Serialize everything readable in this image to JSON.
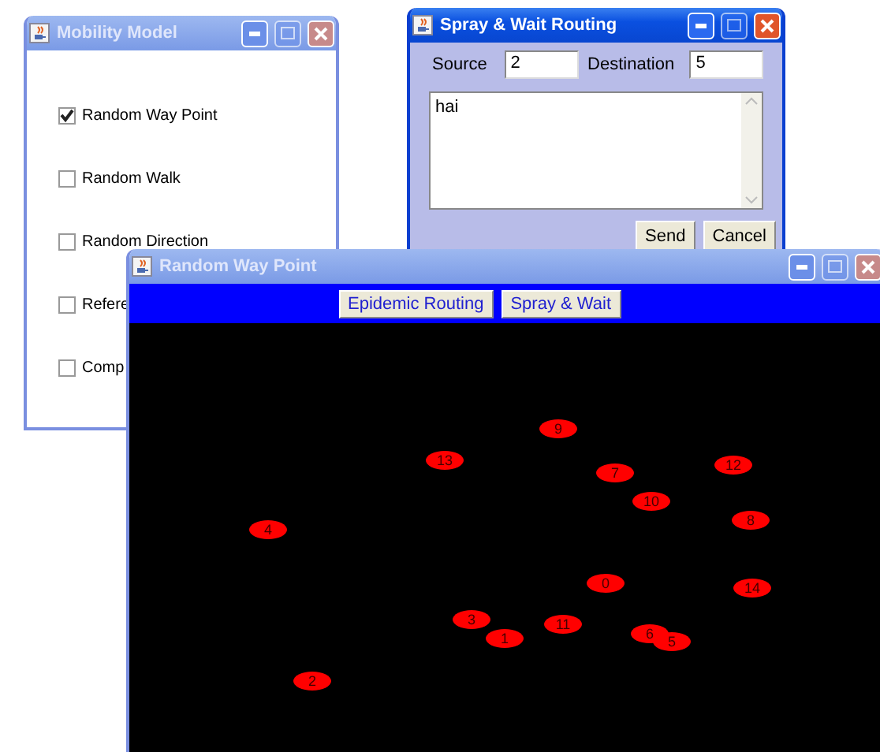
{
  "mobility_window": {
    "title": "Mobility Model",
    "active": false,
    "options": [
      {
        "label": "Random Way Point",
        "checked": true
      },
      {
        "label": "Random Walk",
        "checked": false
      },
      {
        "label": "Random Direction",
        "checked": false
      },
      {
        "label": "Refere",
        "checked": false
      },
      {
        "label": "Comp",
        "checked": false
      }
    ]
  },
  "routing_window": {
    "title": "Spray & Wait Routing",
    "active": true,
    "source_label": "Source",
    "source_value": "2",
    "destination_label": "Destination",
    "destination_value": "5",
    "message": "hai",
    "buttons": [
      "Send",
      "Cancel"
    ]
  },
  "simulation_window": {
    "title": "Random Way Point",
    "active": false,
    "buttons": [
      "Epidemic Routing",
      "Spray & Wait"
    ],
    "nodes": [
      "9",
      "13",
      "7",
      "12",
      "10",
      "8",
      "4",
      "0",
      "14",
      "3",
      "1",
      "11",
      "6",
      "5",
      "2"
    ]
  }
}
